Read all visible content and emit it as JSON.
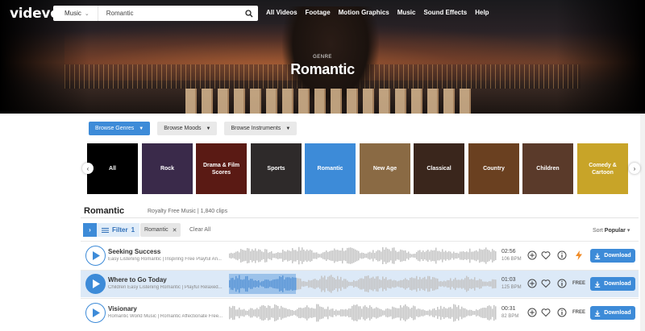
{
  "header": {
    "logo": "videvo",
    "search": {
      "category": "Music",
      "value": "Romantic"
    },
    "nav": [
      "All Videos",
      "Footage",
      "Motion Graphics",
      "Music",
      "Sound Effects",
      "Help"
    ]
  },
  "hero": {
    "kicker": "GENRE",
    "title": "Romantic"
  },
  "browse": {
    "genres": "Browse Genres",
    "moods": "Browse Moods",
    "instruments": "Browse Instruments"
  },
  "genres": [
    {
      "label": "All",
      "color": "#000000"
    },
    {
      "label": "Rock",
      "color": "#3a2a4a"
    },
    {
      "label": "Drama & Film Scores",
      "color": "#5a1a14"
    },
    {
      "label": "Sports",
      "color": "#2e2a2a"
    },
    {
      "label": "Romantic",
      "color": "#3d8bd8",
      "active": true
    },
    {
      "label": "New Age",
      "color": "#8a6a44"
    },
    {
      "label": "Classical",
      "color": "#3a261c"
    },
    {
      "label": "Country",
      "color": "#6a4020"
    },
    {
      "label": "Children",
      "color": "#5a3a2a"
    },
    {
      "label": "Comedy & Cartoon",
      "color": "#c8a428"
    }
  ],
  "results": {
    "title": "Romantic",
    "meta": "Royalty Free Music | 1,840 clips"
  },
  "filters": {
    "filter_label": "Filter",
    "filter_count": "1",
    "chip": "Romantic",
    "clear": "Clear All",
    "sort_label": "Sort",
    "sort_value": "Popular"
  },
  "tracks": [
    {
      "title": "Seeking Success",
      "subtitle": "Easy Listening Romantic | Inspiring Free Playful An...",
      "duration": "02:56",
      "bpm": "106 BPM",
      "badge": "",
      "download": "Download",
      "progress": 0
    },
    {
      "title": "Where to Go Today",
      "subtitle": "Children Easy Listening Romantic | Playful Relaxed...",
      "duration": "01:03",
      "bpm": "125 BPM",
      "badge": "FREE",
      "download": "Download",
      "progress": 0.25
    },
    {
      "title": "Visionary",
      "subtitle": "Romantic World Music | Romantic Affectionate Free...",
      "duration": "00:31",
      "bpm": "82 BPM",
      "badge": "FREE",
      "download": "Download",
      "progress": 0
    }
  ],
  "colors": {
    "accent": "#3d8bd8",
    "premium": "#f08a24",
    "wave": "#c4c4c4",
    "wave_played": "#9cc2ea"
  }
}
